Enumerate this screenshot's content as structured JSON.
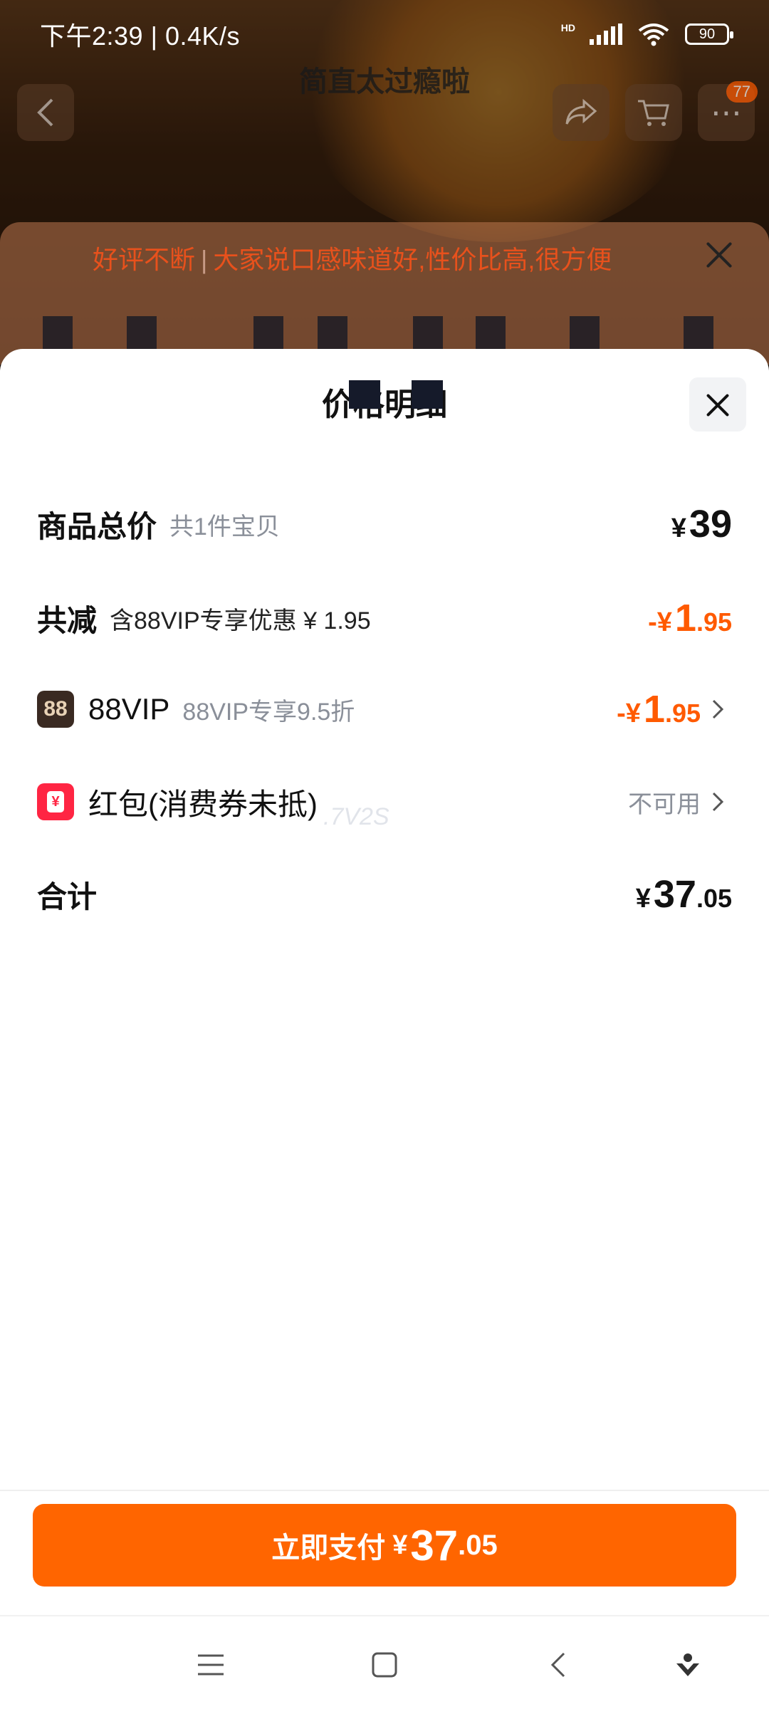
{
  "status_bar": {
    "time": "下午2:39",
    "speed": "0.4K/s",
    "network": "HD",
    "battery": "90",
    "icons": [
      "signal-icon",
      "wifi-icon",
      "battery-icon"
    ]
  },
  "background_page": {
    "title": "简直太过瘾啦",
    "cart_badge": "77",
    "review_banner": {
      "tag": "好评不断",
      "text": "大家说口感味道好,性价比高,很方便"
    }
  },
  "sheet": {
    "title": "价格明细",
    "rows": {
      "total": {
        "label": "商品总价",
        "sub": "共1件宝贝",
        "currency": "¥",
        "int": "39",
        "dec": ""
      },
      "discount": {
        "label": "共减",
        "sub": "含88VIP专享优惠 ¥ 1.95",
        "currency": "-¥",
        "int": "1",
        "dec": ".95"
      },
      "vip": {
        "icon_text": "88",
        "label": "88VIP",
        "sub": "88VIP专享9.5折",
        "currency": "-¥",
        "int": "1",
        "dec": ".95"
      },
      "redpacket": {
        "icon_text": "¥",
        "label": "红包(消费券未抵)",
        "status": "不可用"
      },
      "sum": {
        "label": "合计",
        "currency": "¥",
        "int": "37",
        "dec": ".05"
      }
    },
    "watermark": ".7V2S"
  },
  "pay_button": {
    "label": "立即支付",
    "currency": "¥",
    "int": "37",
    "dec": ".05"
  },
  "colors": {
    "accent": "#ff6500",
    "discount": "#ff5a00",
    "redpacket": "#ff2543",
    "vip": "#3a2a22"
  }
}
